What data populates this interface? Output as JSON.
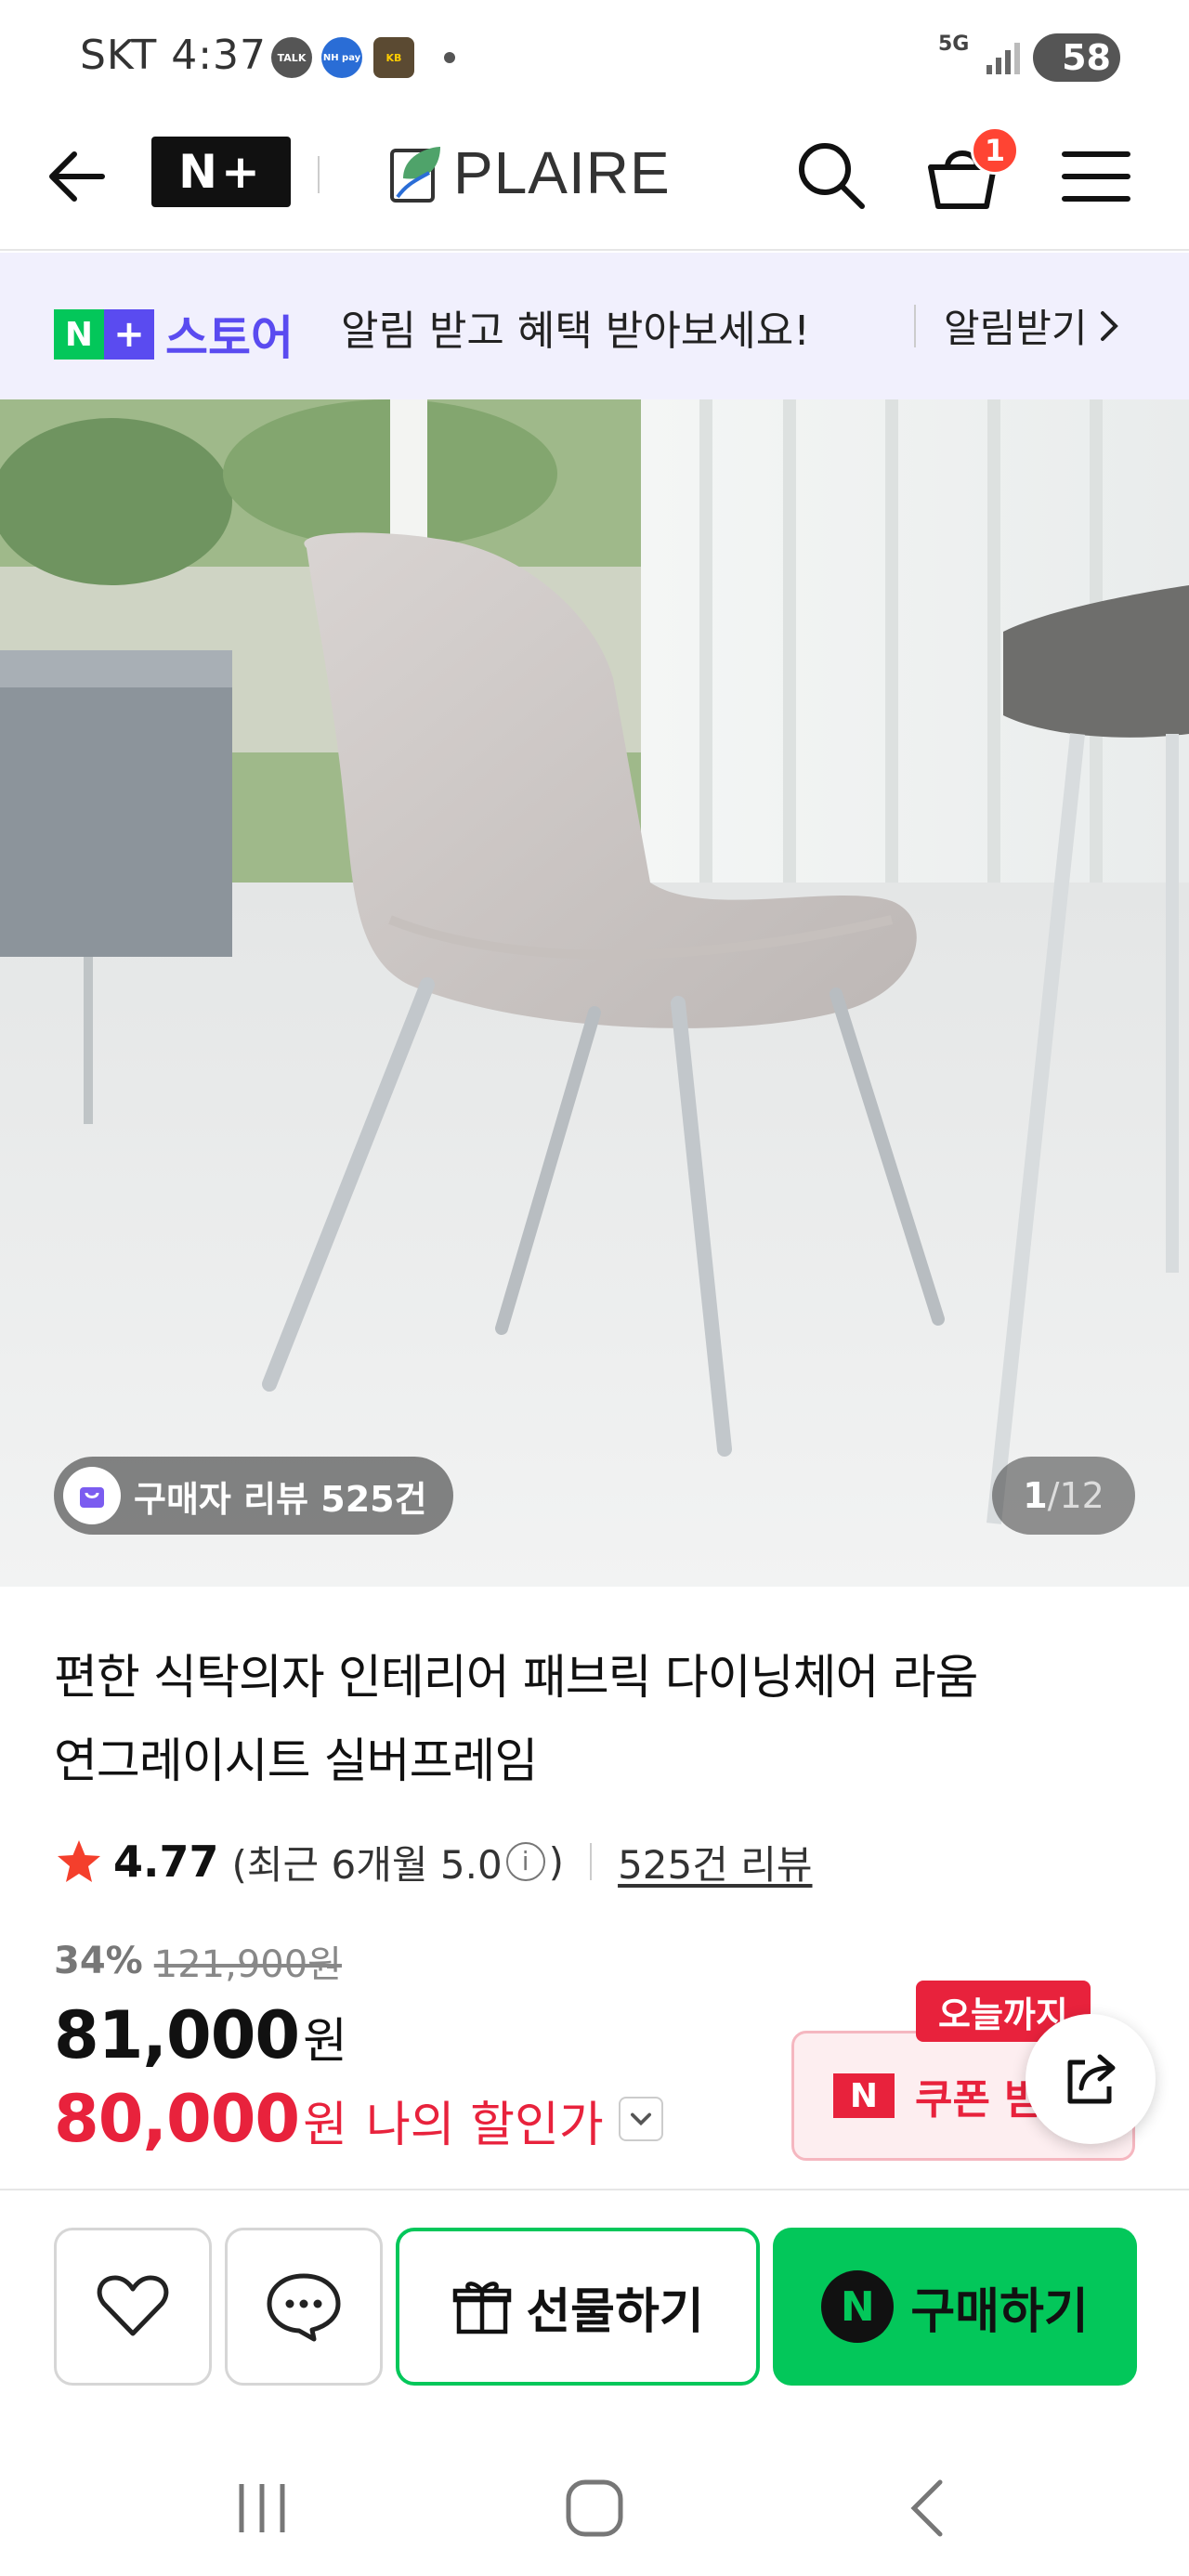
{
  "status_bar": {
    "carrier_time": "SKT 4:37",
    "notifications": [
      "TALK",
      "NH pay",
      "KB"
    ],
    "network": "5G",
    "battery": "58"
  },
  "nav": {
    "nplus_label": "N+",
    "brand_name": "PLAIRE",
    "cart_count": "1"
  },
  "store_banner": {
    "logo_n": "N",
    "logo_plus": "+",
    "store_name": "스토어",
    "message": "알림 받고 혜택 받아보세요!",
    "cta": "알림받기"
  },
  "gallery": {
    "review_badge": "구매자 리뷰 525건",
    "current": "1",
    "separator": "/",
    "total": "12",
    "image_desc": "gray fabric dining chair with silver legs"
  },
  "product": {
    "title_line1": "편한 식탁의자 인테리어 패브릭 다이닝체어 라움",
    "title_line2": "연그레이시트 실버프레임",
    "rating": "4.77",
    "rating_recent_prefix": "(최근 6개월 5.0",
    "rating_recent_suffix": ")",
    "info_symbol": "i",
    "review_link": "525건 리뷰",
    "discount_rate": "34%",
    "original_price": "121,900원",
    "price": "81,000",
    "price_unit": "원",
    "my_price": "80,000",
    "my_price_unit": "원",
    "my_price_label": "나의 할인가"
  },
  "coupon": {
    "tag": "오늘까지",
    "n_label": "N",
    "label": "쿠폰 받기"
  },
  "actions": {
    "gift_label": "선물하기",
    "buy_n": "N",
    "buy_label": "구매하기"
  },
  "colors": {
    "naver_green": "#03c75a",
    "store_purple": "#5a4bf0",
    "sale_red": "#e8223c",
    "banner_bg": "#f1f0fd"
  }
}
